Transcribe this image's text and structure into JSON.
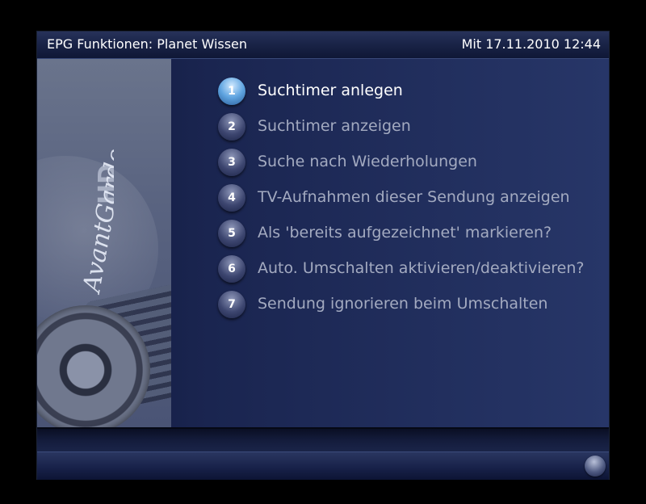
{
  "header": {
    "title": "EPG Funktionen: Planet Wissen",
    "datetime": "Mit 17.11.2010 12:44"
  },
  "brand": {
    "logo_text": "AvantGarde HD"
  },
  "menu": {
    "selected_index": 0,
    "items": [
      {
        "number": "1",
        "label": "Suchtimer anlegen"
      },
      {
        "number": "2",
        "label": "Suchtimer anzeigen"
      },
      {
        "number": "3",
        "label": "Suche nach Wiederholungen"
      },
      {
        "number": "4",
        "label": "TV-Aufnahmen dieser Sendung anzeigen"
      },
      {
        "number": "5",
        "label": "Als 'bereits aufgezeichnet' markieren?"
      },
      {
        "number": "6",
        "label": "Auto. Umschalten aktivieren/deaktivieren?"
      },
      {
        "number": "7",
        "label": "Sendung ignorieren beim Umschalten"
      }
    ]
  },
  "colors": {
    "active_text": "#ffffff",
    "inactive_text": "#a3aac0",
    "active_bullet": "#5fa4e0"
  }
}
